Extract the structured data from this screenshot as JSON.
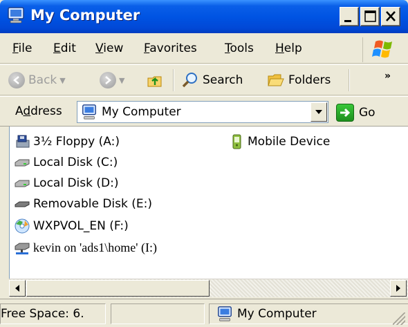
{
  "window": {
    "title": "My Computer"
  },
  "menu": {
    "items": [
      "File",
      "Edit",
      "View",
      "Favorites",
      "Tools",
      "Help"
    ]
  },
  "toolbar": {
    "back_label": "Back",
    "search_label": "Search",
    "folders_label": "Folders",
    "overflow": "»"
  },
  "address": {
    "label_underlined": "d",
    "label_rest_a": "A",
    "label_rest_b": "dress",
    "value": "My Computer",
    "go_label": "Go"
  },
  "items": [
    {
      "label": "3½ Floppy (A:)",
      "icon": "floppy-drive-icon"
    },
    {
      "label": "Local Disk (C:)",
      "icon": "hard-disk-icon"
    },
    {
      "label": "Local Disk (D:)",
      "icon": "hard-disk-icon"
    },
    {
      "label": "Removable Disk (E:)",
      "icon": "removable-disk-icon"
    },
    {
      "label": "WXPVOL_EN (F:)",
      "icon": "cd-drive-icon"
    },
    {
      "label": "kevin on 'ads1\\home' (I:)",
      "icon": "network-drive-icon"
    },
    {
      "label": "Mobile Device",
      "icon": "mobile-device-icon"
    }
  ],
  "status": {
    "free_space": "Free Space: 6.",
    "location": "My Computer"
  },
  "colors": {
    "titlebar": "#0054e3",
    "face": "#ece9d8",
    "border": "#7f9db9"
  }
}
